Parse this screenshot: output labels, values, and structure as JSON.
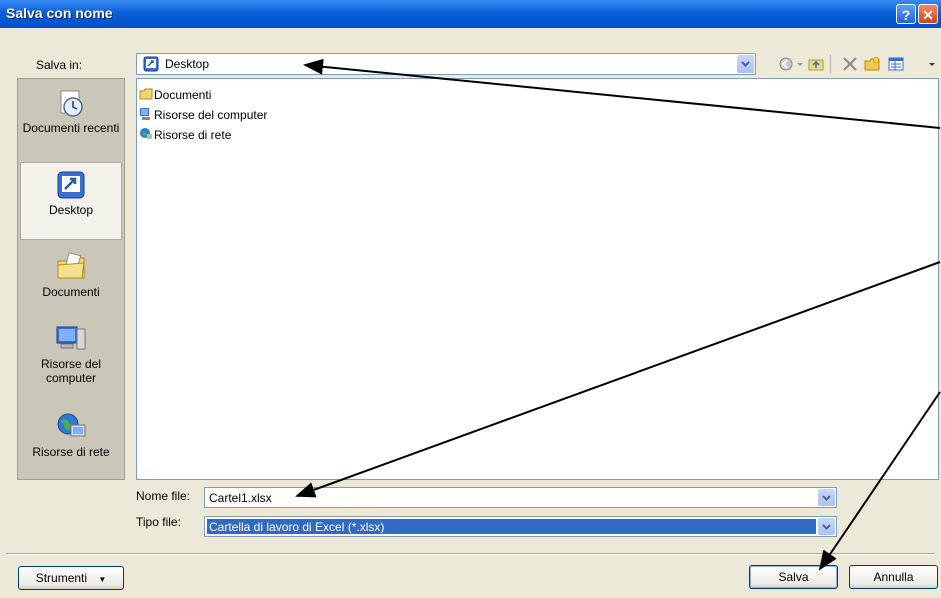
{
  "window": {
    "title": "Salva con nome"
  },
  "header": {
    "save_in_label": "Salva in:",
    "location": "Desktop"
  },
  "places": [
    {
      "label": "Documenti recenti"
    },
    {
      "label": "Desktop"
    },
    {
      "label": "Documenti"
    },
    {
      "label": "Risorse del computer"
    },
    {
      "label": "Risorse di rete"
    }
  ],
  "files": [
    {
      "name": "Documenti",
      "icon": "folder-icon"
    },
    {
      "name": "Risorse del computer",
      "icon": "computer-icon"
    },
    {
      "name": "Risorse di rete",
      "icon": "network-icon"
    }
  ],
  "form": {
    "filename_label": "Nome file:",
    "filename_value": "Cartel1.xlsx",
    "filetype_label": "Tipo file:",
    "filetype_value": "Cartella di lavoro di Excel (*.xlsx)"
  },
  "footer": {
    "tools_label": "Strumenti",
    "save_label": "Salva",
    "cancel_label": "Annulla"
  },
  "colors": {
    "titlebar": "#0a5fd8",
    "selection": "#316ac5",
    "arrow": "#000000"
  }
}
